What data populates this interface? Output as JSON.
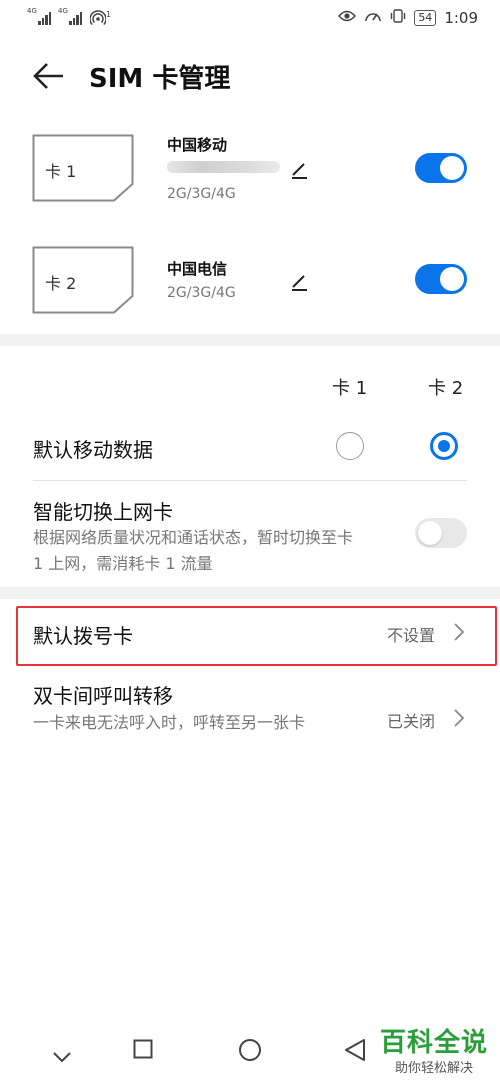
{
  "status_bar": {
    "signal1_label": "4G",
    "signal2_label": "4G",
    "hotspot_badge": "1",
    "battery": "54",
    "time": "1:09"
  },
  "header": {
    "title": "SIM 卡管理"
  },
  "sims": [
    {
      "card_label": "卡 1",
      "carrier": "中国移动",
      "network": "2G/3G/4G",
      "enabled": true
    },
    {
      "card_label": "卡 2",
      "carrier": "中国电信",
      "network": "2G/3G/4G",
      "enabled": true
    }
  ],
  "columns": {
    "card1": "卡 1",
    "card2": "卡 2"
  },
  "default_data": {
    "label": "默认移动数据",
    "selected": "card2"
  },
  "smart_switch": {
    "label": "智能切换上网卡",
    "description": "根据网络质量状况和通话状态，暂时切换至卡 1 上网，需消耗卡 1 流量",
    "enabled": false
  },
  "default_call": {
    "label": "默认拨号卡",
    "value": "不设置"
  },
  "call_forward": {
    "label": "双卡间呼叫转移",
    "description": "一卡来电无法呼入时，呼转至另一张卡",
    "value": "已关闭"
  },
  "watermark": {
    "title": "百科全说",
    "subtitle": "助你轻松解决"
  },
  "colors": {
    "accent": "#0a74ea",
    "highlight": "#e5333b",
    "watermark": "#2b9e3c"
  }
}
